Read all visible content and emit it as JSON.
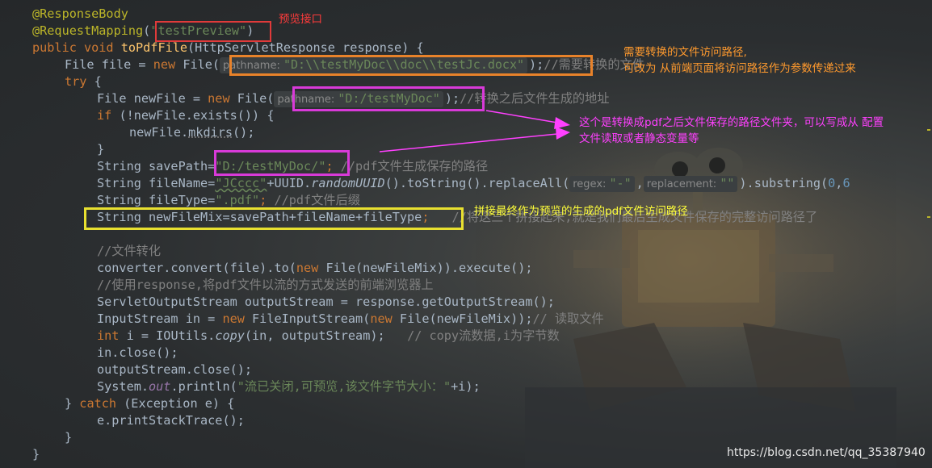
{
  "code": {
    "l1": {
      "ann": "@ResponseBody"
    },
    "l2": {
      "ann": "@RequestMapping",
      "p1": "(",
      "str": "\"testPreview\"",
      "p2": ")"
    },
    "l3": {
      "kw": "public void ",
      "fn": "toPdfFile",
      "rest": "(HttpServletResponse response) {"
    },
    "l4": {
      "a": "File file = ",
      "kw": "new ",
      "b": "File(",
      "hint": "pathname:",
      "str": "\"D:\\\\testMyDoc\\\\doc\\\\testJc.docx\"",
      "c": ");",
      "cmt": "//需要转换的文件"
    },
    "l5": {
      "kw": "try",
      "rest": " {"
    },
    "l6": {
      "a": "File newFile = ",
      "kw": "new ",
      "b": "File(",
      "hint": "pathname:",
      "str": "\"D:/testMyDoc\"",
      "c": ");",
      "cmt": "//转换之后文件生成的地址"
    },
    "l7": {
      "kw": "if",
      "rest": " (!newFile.exists()) {"
    },
    "l8": {
      "a": "newFile.",
      "fn": "mkdirs",
      "b": "();"
    },
    "l9": {
      "text": "}"
    },
    "l10": {
      "a": "String savePath=",
      "str": "\"D:/testMyDoc/\"",
      "b": "; ",
      "cmt": "//pdf文件生成保存的路径"
    },
    "l11": {
      "a": "String fileName=",
      "str1": "\"JCccc\"",
      "b": "+UUID.",
      "ital": "randomUUID",
      "c": "().toString().replaceAll(",
      "hint1": "regex:",
      "str2": "\"-\"",
      "d": ",",
      "hint2": "replacement:",
      "str3": "\"\"",
      "e": ").substring(",
      "n1": "0",
      "f": ",",
      "n2": "6"
    },
    "l12": {
      "a": "String fileType=",
      "str": "\".pdf\"",
      "b": "; ",
      "cmt": "//pdf文件后缀"
    },
    "l13": {
      "a": "String newFileMix=savePath+fileName+fileType",
      "b": ";",
      "cmt": "//将这三个拼接起来,就是我们最后生成文件保存的完整访问路径了"
    },
    "l15": {
      "cmt": "//文件转化"
    },
    "l16": {
      "a": "converter.convert(file).to(",
      "kw": "new ",
      "b": "File(newFileMix)).execute();"
    },
    "l17": {
      "cmt": "//使用response,将pdf文件以流的方式发送的前端浏览器上"
    },
    "l18": {
      "text": "ServletOutputStream outputStream = response.getOutputStream();"
    },
    "l19": {
      "a": "InputStream in = ",
      "kw1": "new ",
      "b": "FileInputStream(",
      "kw2": "new ",
      "c": "File(newFileMix));",
      "cmt": "// 读取文件"
    },
    "l20": {
      "kw": "int ",
      "a": "i = IOUtils.",
      "ital": "copy",
      "b": "(in, outputStream);   ",
      "cmt": "// copy流数据,i为字节数"
    },
    "l21": {
      "text": "in.close();"
    },
    "l22": {
      "text": "outputStream.close();"
    },
    "l23": {
      "a": "System.",
      "field": "out",
      "b": ".println(",
      "str": "\"流已关闭,可预览,该文件字节大小：\"",
      "c": "+i);"
    },
    "l24": {
      "a": "} ",
      "kw": "catch",
      "b": " (Exception e) {"
    },
    "l25": {
      "text": "e.printStackTrace();"
    },
    "l26": {
      "text": "}"
    },
    "l27": {
      "text": "}"
    }
  },
  "annotations": {
    "preview": "预览接口",
    "path1": "需要转换的文件访问路径,",
    "path2": "可改为 从前端页面将访问路径作为参数传递过来",
    "folder1": "这个是转换成pdf之后文件保存的路径文件夹，可以写成从 配置",
    "folder2": "文件读取或者静态变量等",
    "combine": "拼接最终作为预览的生成的pdf文件访问路径"
  },
  "watermark": "https://blog.csdn.net/qq_35387940",
  "colors": {
    "red_box": "#e03a3a",
    "orange_box": "#e8822a",
    "magenta_box": "#d83ad8",
    "yellow_box": "#e8e030",
    "annotation_red": "#ff3b3b",
    "annotation_orange": "#ff9a2e",
    "annotation_magenta": "#ff40ff",
    "annotation_yellow": "#ffff3a"
  }
}
